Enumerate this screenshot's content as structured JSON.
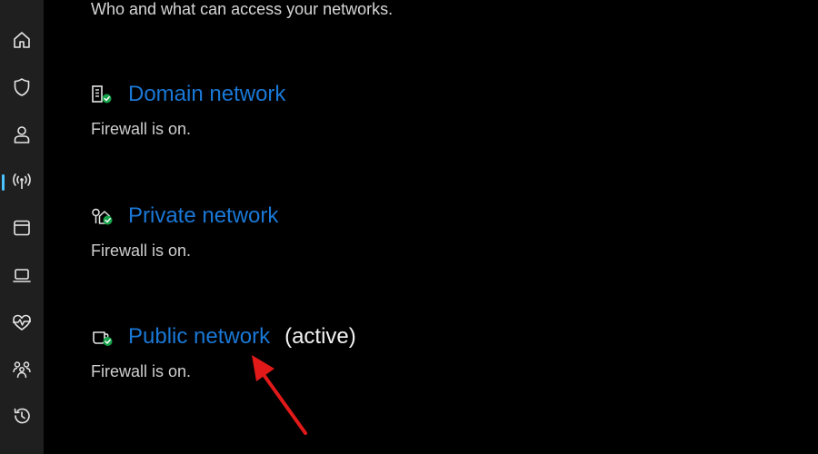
{
  "main": {
    "subtitle": "Who and what can access your networks."
  },
  "sidebar": {
    "items": [
      {
        "icon": "home-icon",
        "selected": false
      },
      {
        "icon": "shield-icon",
        "selected": false
      },
      {
        "icon": "person-icon",
        "selected": false
      },
      {
        "icon": "wifi-signal-icon",
        "selected": true
      },
      {
        "icon": "app-browser-icon",
        "selected": false
      },
      {
        "icon": "laptop-icon",
        "selected": false
      },
      {
        "icon": "heart-pulse-icon",
        "selected": false
      },
      {
        "icon": "family-icon",
        "selected": false
      },
      {
        "icon": "history-icon",
        "selected": false
      }
    ]
  },
  "networks": [
    {
      "label": "Domain network",
      "status": "Firewall is on.",
      "icon": "domain-building-icon",
      "active_label": ""
    },
    {
      "label": "Private network",
      "status": "Firewall is on.",
      "icon": "private-home-icon",
      "active_label": ""
    },
    {
      "label": "Public network",
      "status": "Firewall is on.",
      "icon": "public-cafe-icon",
      "active_label": "(active)"
    }
  ],
  "colors": {
    "background": "#000000",
    "sidebar": "#1f1f1f",
    "link": "#1a78d6",
    "status_text": "#cfcfcf",
    "check_badge": "#16a34a",
    "selection_indicator": "#4cc2ff",
    "annotation_arrow": "#e11919"
  }
}
